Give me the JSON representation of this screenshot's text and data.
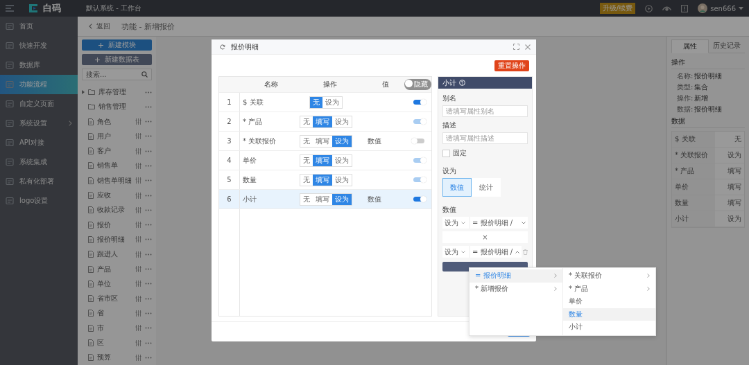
{
  "topbar": {
    "logo": "白码",
    "breadcrumb": "默认系统 - 工作台",
    "upgrade_badge": "升级/续费",
    "user": "sen666"
  },
  "sidebar": {
    "items": [
      {
        "label": "首页",
        "selected": false,
        "submenu": false
      },
      {
        "label": "快速开发",
        "selected": false,
        "submenu": false
      },
      {
        "label": "数据库",
        "selected": false,
        "submenu": false
      },
      {
        "label": "功能流程",
        "selected": true,
        "submenu": false
      },
      {
        "label": "自定义页面",
        "selected": false,
        "submenu": false
      },
      {
        "label": "系统设置",
        "selected": false,
        "submenu": true
      },
      {
        "label": "API对接",
        "selected": false,
        "submenu": false
      },
      {
        "label": "系统集成",
        "selected": false,
        "submenu": false
      },
      {
        "label": "私有化部署",
        "selected": false,
        "submenu": false
      },
      {
        "label": "logo设置",
        "selected": false,
        "submenu": false
      }
    ]
  },
  "subheader": {
    "back": "返回",
    "title": "功能 - 新增报价"
  },
  "tree_panel": {
    "buttons": [
      {
        "label": "新建模块",
        "kind": "primary"
      },
      {
        "label": "新建数据表",
        "kind": "dark"
      }
    ],
    "search": {
      "placeholder": "搜索..."
    },
    "items": [
      {
        "label": "库存管理",
        "kind": "folder",
        "expandable": true
      },
      {
        "label": "销售管理",
        "kind": "folder",
        "expandable": false
      },
      {
        "label": "角色",
        "kind": "table",
        "expandable": false
      },
      {
        "label": "用户",
        "kind": "table",
        "expandable": false
      },
      {
        "label": "客户",
        "kind": "table",
        "expandable": false
      },
      {
        "label": "销售单",
        "kind": "table",
        "expandable": false
      },
      {
        "label": "销售单明细",
        "kind": "table",
        "expandable": false
      },
      {
        "label": "应收",
        "kind": "table",
        "expandable": false
      },
      {
        "label": "收款记录",
        "kind": "table",
        "expandable": false
      },
      {
        "label": "报价",
        "kind": "table",
        "expandable": false
      },
      {
        "label": "报价明细",
        "kind": "table",
        "expandable": false
      },
      {
        "label": "跟进人",
        "kind": "table",
        "expandable": false
      },
      {
        "label": "产品",
        "kind": "table",
        "expandable": false
      },
      {
        "label": "单位",
        "kind": "table",
        "expandable": false
      },
      {
        "label": "省市区",
        "kind": "table",
        "expandable": false
      },
      {
        "label": "省",
        "kind": "table",
        "expandable": false
      },
      {
        "label": "市",
        "kind": "table",
        "expandable": false
      },
      {
        "label": "区",
        "kind": "table",
        "expandable": false
      },
      {
        "label": "预算",
        "kind": "table",
        "expandable": false
      }
    ]
  },
  "modal": {
    "title": "报价明细",
    "reset_button": "重置操作",
    "table": {
      "columns": [
        "名称",
        "操作",
        "值"
      ],
      "hide_toggle": {
        "label": "隐藏",
        "on": false
      },
      "rows": [
        {
          "index": "1",
          "name": "$ 关联",
          "options": [
            {
              "label": "无",
              "selected": true
            },
            {
              "label": "设为",
              "selected": false
            }
          ],
          "on": true,
          "disabled": false,
          "selected": false
        },
        {
          "index": "2",
          "name": "* 产品",
          "options": [
            {
              "label": "无",
              "selected": false
            },
            {
              "label": "填写",
              "selected": true
            },
            {
              "label": "设为",
              "selected": false
            }
          ],
          "on": true,
          "disabled": true,
          "selected": false
        },
        {
          "index": "3",
          "name": "* 关联报价",
          "options": [
            {
              "label": "无",
              "selected": false
            },
            {
              "label": "填写",
              "selected": false
            },
            {
              "label": "设为",
              "selected": true
            }
          ],
          "value": "数值",
          "on": false,
          "disabled": false,
          "selected": false
        },
        {
          "index": "4",
          "name": "单价",
          "options": [
            {
              "label": "无",
              "selected": false
            },
            {
              "label": "填写",
              "selected": true
            },
            {
              "label": "设为",
              "selected": false
            }
          ],
          "on": true,
          "disabled": true,
          "selected": false
        },
        {
          "index": "5",
          "name": "数量",
          "options": [
            {
              "label": "无",
              "selected": false
            },
            {
              "label": "填写",
              "selected": true
            },
            {
              "label": "设为",
              "selected": false
            }
          ],
          "on": true,
          "disabled": true,
          "selected": false
        },
        {
          "index": "6",
          "name": "小计",
          "options": [
            {
              "label": "无",
              "selected": false
            },
            {
              "label": "填写",
              "selected": false
            },
            {
              "label": "设为",
              "selected": true
            }
          ],
          "value": "数值",
          "on": true,
          "disabled": false,
          "selected": true
        }
      ]
    },
    "detail": {
      "title": "小计",
      "alias": {
        "label": "别名",
        "placeholder": "请填写属性别名"
      },
      "description": {
        "label": "描述",
        "placeholder": "请填写属性描述"
      },
      "fixed": {
        "label": "固定",
        "checked": false
      },
      "set_as": {
        "label": "设为",
        "options": [
          {
            "label": "数值",
            "selected": true
          },
          {
            "label": "统计",
            "selected": false
          }
        ]
      },
      "value": {
        "label": "数值",
        "operator": "×",
        "rows": [
          {
            "mode": "设为",
            "source": "= 报价明细 /",
            "open": false,
            "deletable": false
          },
          {
            "mode": "设为",
            "source": "= 报价明细 /",
            "open": true,
            "deletable": true
          }
        ]
      }
    },
    "cascader": {
      "columns": [
        {
          "items": [
            {
              "label": "= 报价明细",
              "selected": true,
              "has_children": true
            },
            {
              "label": "* 新增报价",
              "selected": false,
              "has_children": true
            }
          ]
        },
        {
          "items": [
            {
              "label": "* 关联报价",
              "selected": false,
              "has_children": true
            },
            {
              "label": "* 产品",
              "selected": false,
              "has_children": true
            },
            {
              "label": "单价",
              "selected": false,
              "has_children": false
            },
            {
              "label": "数量",
              "selected": true,
              "has_children": false
            },
            {
              "label": "小计",
              "selected": false,
              "has_children": false
            }
          ]
        }
      ]
    }
  },
  "right_panel": {
    "tabs": [
      {
        "label": "属性",
        "selected": true
      },
      {
        "label": "历史记录",
        "selected": false
      }
    ],
    "operation": {
      "title": "操作",
      "fields": [
        {
          "label": "名称:",
          "value": "报价明细"
        },
        {
          "label": "类型:",
          "value": "集合"
        },
        {
          "label": "操作:",
          "value": "新增"
        },
        {
          "label": "数据:",
          "value": "报价明细"
        }
      ]
    },
    "data": {
      "title": "数据",
      "rows": [
        {
          "name": "$ 关联",
          "action": "无"
        },
        {
          "name": "* 关联报价",
          "action": "设为"
        },
        {
          "name": "* 产品",
          "action": "填写"
        },
        {
          "name": "单价",
          "action": "填写"
        },
        {
          "name": "数量",
          "action": "填写"
        },
        {
          "name": "小计",
          "action": "设为"
        }
      ]
    }
  }
}
